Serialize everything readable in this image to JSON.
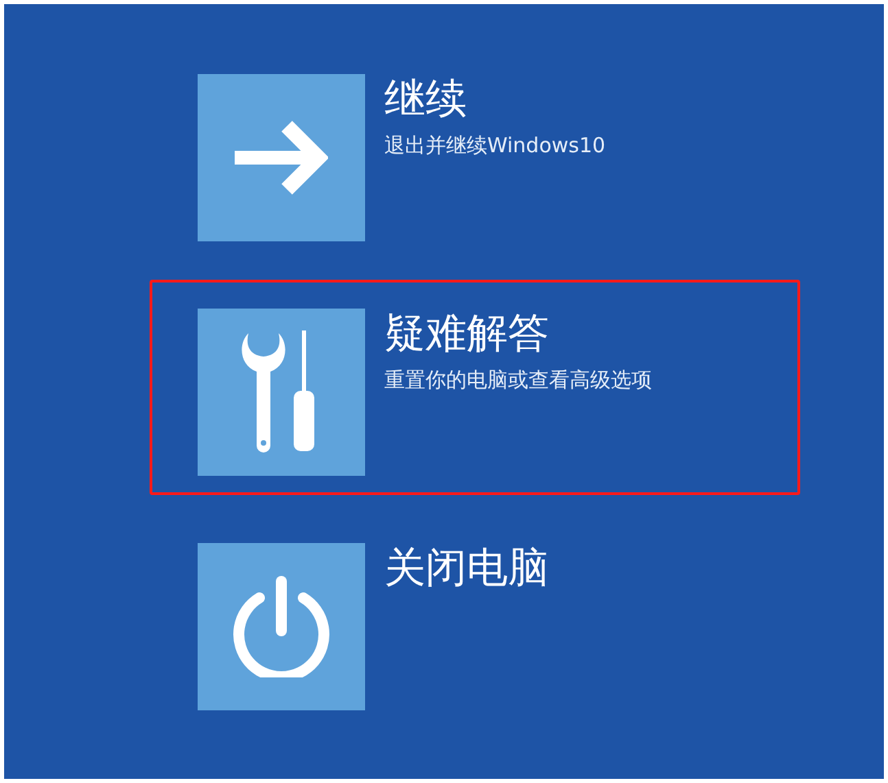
{
  "options": [
    {
      "kind": "arrow",
      "title": "继续",
      "description": "退出并继续Windows10",
      "highlighted": false
    },
    {
      "kind": "tools",
      "title": "疑难解答",
      "description": "重置你的电脑或查看高级选项",
      "highlighted": true
    },
    {
      "kind": "power",
      "title": "关闭电脑",
      "highlighted": false
    }
  ]
}
